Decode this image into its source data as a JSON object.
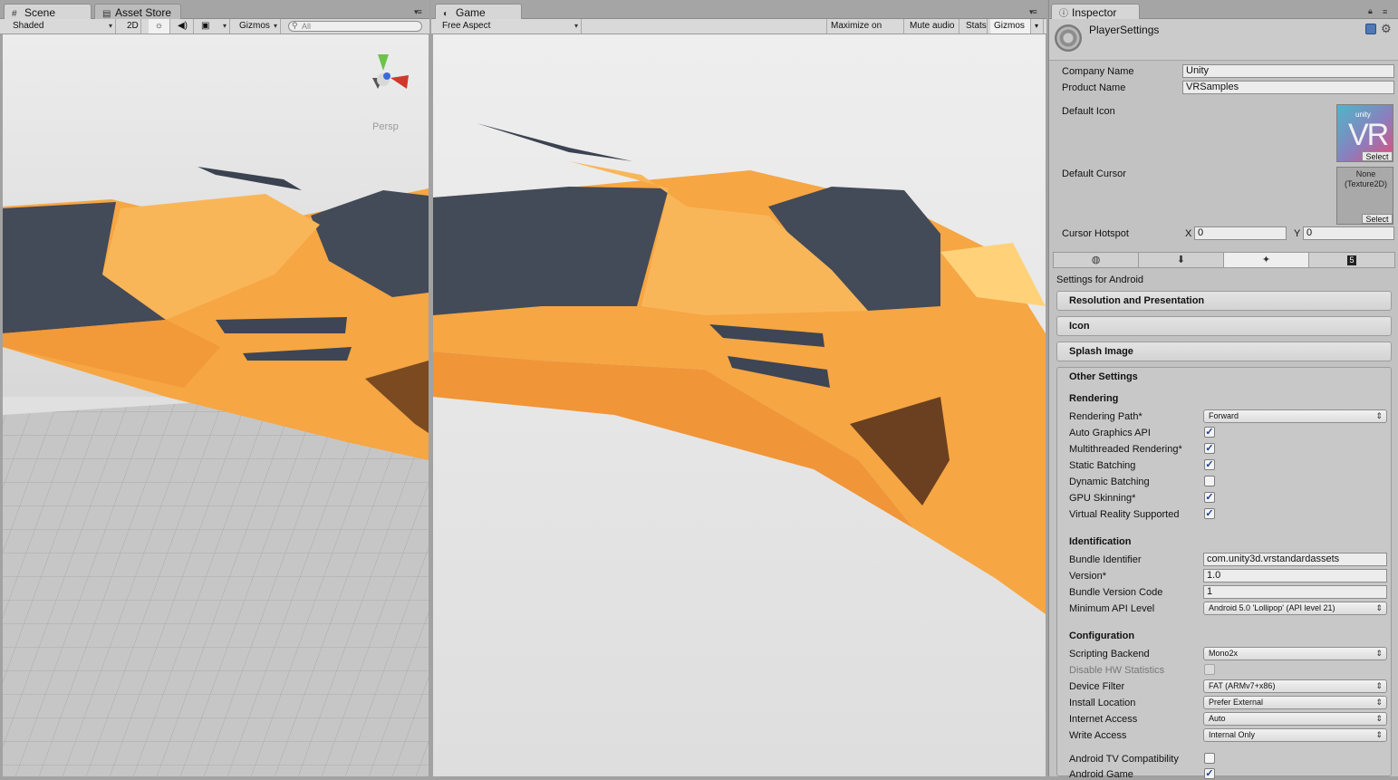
{
  "scene": {
    "tabs": [
      {
        "label": "Scene",
        "icon": "grid-icon"
      },
      {
        "label": "Asset Store",
        "icon": "store-icon"
      }
    ],
    "toolbar": {
      "shading": "Shaded",
      "mode_2d": "2D",
      "gizmos": "Gizmos",
      "search_placeholder": "All"
    },
    "persp_label": "Persp"
  },
  "game": {
    "tab": "Game",
    "toolbar": {
      "aspect": "Free Aspect",
      "maximize": "Maximize on Play",
      "mute": "Mute audio",
      "stats": "Stats",
      "gizmos": "Gizmos"
    }
  },
  "inspector": {
    "tab": "Inspector",
    "title": "PlayerSettings",
    "company_label": "Company Name",
    "company_value": "Unity",
    "product_label": "Product Name",
    "product_value": "VRSamples",
    "default_icon_label": "Default Icon",
    "default_cursor_label": "Default Cursor",
    "cursor_none": "None",
    "cursor_type": "(Texture2D)",
    "select": "Select",
    "hotspot_label": "Cursor Hotspot",
    "hotspot_x_label": "X",
    "hotspot_x": "0",
    "hotspot_y_label": "Y",
    "hotspot_y": "0",
    "icon_brand": "unity",
    "icon_text": "VR",
    "platform_tabs": [
      "globe-icon",
      "download-icon",
      "android-icon",
      "html5-icon"
    ],
    "settings_for": "Settings for Android",
    "foldouts": [
      "Resolution and Presentation",
      "Icon",
      "Splash Image",
      "Other Settings"
    ],
    "rendering": {
      "header": "Rendering",
      "path_label": "Rendering Path*",
      "path_value": "Forward",
      "rows": [
        {
          "label": "Auto Graphics API",
          "checked": true
        },
        {
          "label": "Multithreaded Rendering*",
          "checked": true
        },
        {
          "label": "Static Batching",
          "checked": true
        },
        {
          "label": "Dynamic Batching",
          "checked": false
        },
        {
          "label": "GPU Skinning*",
          "checked": true
        },
        {
          "label": "Virtual Reality Supported",
          "checked": true
        }
      ]
    },
    "identification": {
      "header": "Identification",
      "bundle_id_label": "Bundle Identifier",
      "bundle_id": "com.unity3d.vrstandardassets",
      "version_label": "Version*",
      "version": "1.0",
      "code_label": "Bundle Version Code",
      "code": "1",
      "min_api_label": "Minimum API Level",
      "min_api": "Android 5.0 'Lollipop' (API level 21)"
    },
    "configuration": {
      "header": "Configuration",
      "backend_label": "Scripting Backend",
      "backend": "Mono2x",
      "hw_label": "Disable HW Statistics",
      "device_label": "Device Filter",
      "device": "FAT (ARMv7+x86)",
      "install_label": "Install Location",
      "install": "Prefer External",
      "internet_label": "Internet Access",
      "internet": "Auto",
      "write_label": "Write Access",
      "write": "Internal Only",
      "tv_label": "Android TV Compatibility",
      "game_label": "Android Game"
    }
  },
  "colors": {
    "orange": "#f6a643",
    "dark": "#434a58",
    "check": "#1c3f8c"
  }
}
